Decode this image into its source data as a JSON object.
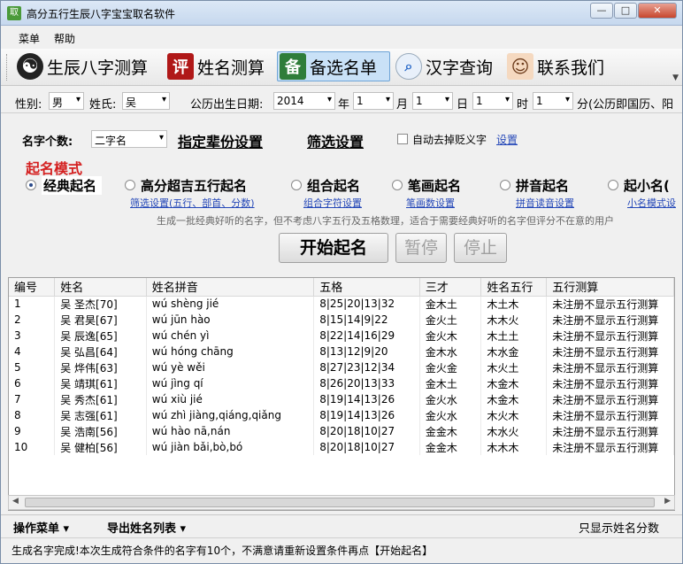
{
  "window": {
    "title": "高分五行生辰八字宝宝取名软件",
    "icon_text": "取"
  },
  "menu": [
    "菜单",
    "帮助"
  ],
  "toolbar": {
    "buttons": [
      {
        "icon": "yin-yang-icon",
        "icon_glyph": "☯",
        "label": "生辰八字测算"
      },
      {
        "icon": "ping-icon",
        "icon_glyph": "评",
        "label": "姓名测算"
      },
      {
        "icon": "bei-icon",
        "icon_glyph": "备",
        "label": "备选名单"
      },
      {
        "icon": "magnifier-icon",
        "icon_glyph": "🔍",
        "label": "汉字查询"
      },
      {
        "icon": "contact-avatar-icon",
        "icon_glyph": "☺",
        "label": "联系我们"
      }
    ],
    "active_index": 2
  },
  "params": {
    "gender_label": "性别:",
    "gender_value": "男",
    "surname_label": "姓氏:",
    "surname_value": "吴",
    "date_label": "公历出生日期:",
    "year": "2014",
    "year_unit": "年",
    "month": "1",
    "month_unit": "月",
    "day": "1",
    "day_unit": "日",
    "hour": "1",
    "hour_unit": "时",
    "minute": "1",
    "minute_unit": "分(公历即国历、阳"
  },
  "settings": {
    "name_length_label": "名字个数:",
    "name_length_value": "二字名",
    "generation_link": "指定辈份设置",
    "filter_link": "筛选设置",
    "auto_remove_label": "自动去掉贬义字",
    "auto_remove_settings": "设置",
    "mode_title": "起名模式",
    "modes": [
      {
        "label": "经典起名",
        "sub": ""
      },
      {
        "label": "高分超吉五行起名",
        "sub": "筛选设置(五行、部首、分数)"
      },
      {
        "label": "组合起名",
        "sub": "组合字符设置"
      },
      {
        "label": "笔画起名",
        "sub": "笔画数设置"
      },
      {
        "label": "拼音起名",
        "sub": "拼音读音设置"
      },
      {
        "label": "起小名(",
        "sub": "小名模式设"
      }
    ],
    "selected_mode": 0,
    "hint": "生成一批经典好听的名字，但不考虑八字五行及五格数理，适合于需要经典好听的名字但评分不在意的用户",
    "start_button": "开始起名",
    "pause_button": "暂停",
    "stop_button": "停止"
  },
  "table": {
    "columns": [
      "编号",
      "姓名",
      "姓名拼音",
      "五格",
      "三才",
      "姓名五行",
      "五行测算"
    ],
    "rows": [
      [
        "1",
        "吴 圣杰[70]",
        "wú shèng jié",
        "8|25|20|13|32",
        "金木土",
        "木土木",
        "未注册不显示五行测算"
      ],
      [
        "2",
        "吴 君昊[67]",
        "wú jūn hào",
        "8|15|14|9|22",
        "金火土",
        "木木火",
        "未注册不显示五行测算"
      ],
      [
        "3",
        "吴 辰逸[65]",
        "wú chén yì",
        "8|22|14|16|29",
        "金火木",
        "木土土",
        "未注册不显示五行测算"
      ],
      [
        "4",
        "吴 弘昌[64]",
        "wú hóng chāng",
        "8|13|12|9|20",
        "金木水",
        "木水金",
        "未注册不显示五行测算"
      ],
      [
        "5",
        "吴 烨伟[63]",
        "wú yè wěi",
        "8|27|23|12|34",
        "金火金",
        "木火土",
        "未注册不显示五行测算"
      ],
      [
        "6",
        "吴 靖琪[61]",
        "wú jìng qí",
        "8|26|20|13|33",
        "金木土",
        "木金木",
        "未注册不显示五行测算"
      ],
      [
        "7",
        "吴 秀杰[61]",
        "wú xiù jié",
        "8|19|14|13|26",
        "金火水",
        "木金木",
        "未注册不显示五行测算"
      ],
      [
        "8",
        "吴 志强[61]",
        "wú zhì jiàng,qiáng,qiǎng",
        "8|19|14|13|26",
        "金火水",
        "木火木",
        "未注册不显示五行测算"
      ],
      [
        "9",
        "吴 浩南[56]",
        "wú hào nā,nán",
        "8|20|18|10|27",
        "金金木",
        "木水火",
        "未注册不显示五行测算"
      ],
      [
        "10",
        "吴 健柏[56]",
        "wú jiàn bǎi,bò,bó",
        "8|20|18|10|27",
        "金金木",
        "木木木",
        "未注册不显示五行测算"
      ]
    ]
  },
  "bottombar": {
    "ops_menu": "操作菜单",
    "export_menu": "导出姓名列表",
    "right_text": "只显示姓名分数"
  },
  "status": "生成名字完成!本次生成符合条件的名字有10个，不满意请重新设置条件再点【开始起名】"
}
